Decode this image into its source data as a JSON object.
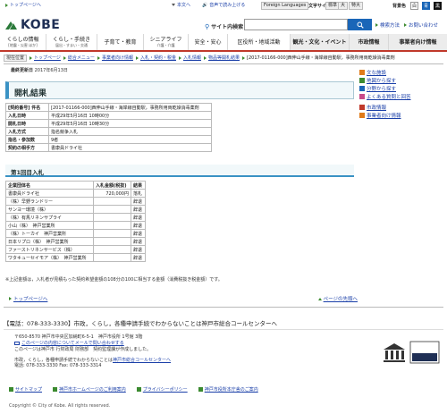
{
  "topbar": {
    "top_link": "トップページへ",
    "text_version": "本文へ",
    "speech": "音声で読み上げる",
    "foreign": "Foreign Languages",
    "font_size_label": "文字サイズ",
    "font_standard": "標準",
    "font_large": "大",
    "font_xlarge": "特大",
    "bg_label": "背景色",
    "bg_white": "白",
    "bg_blue": "青",
    "bg_black": "黒"
  },
  "header": {
    "logo_text": "KOBE",
    "search_label": "サイト内検索",
    "search_placeholder": "",
    "search_method": "検索方法",
    "inquiry": "お問い合わせ"
  },
  "nav": [
    {
      "label": "くらしの情報",
      "sub": "[地震・災害 ほか]"
    },
    {
      "label": "くらし・手続き",
      "sub": "届出・すまい・交通"
    },
    {
      "label": "子育て・教育",
      "sub": ""
    },
    {
      "label": "シニアライフ",
      "sub": "介護・介護"
    },
    {
      "label": "安全・安心",
      "sub": ""
    },
    {
      "label": "区役所・地域活動",
      "sub": ""
    },
    {
      "label": "観光・文化・イベント",
      "sub": ""
    },
    {
      "label": "市政情報",
      "sub": ""
    },
    {
      "label": "事業者向け情報",
      "sub": ""
    }
  ],
  "breadcrumb": {
    "here": "現在位置",
    "items": [
      "トップページ",
      "総合メニュー",
      "事業者向け情報",
      "入札・契約・税金",
      "入札情報",
      "物品等開札結果"
    ],
    "current": "[2017-01166-000]西伸山手線・海岸線自動駅，事務所用両乾燥消毒薬剤"
  },
  "updated": {
    "label": "最終更新日",
    "date": "2017年6月13日"
  },
  "right_links": [
    {
      "label": "文な施設",
      "color": "#1a3fa8"
    },
    {
      "label": "地図から探す",
      "color": "#1a3fa8"
    },
    {
      "label": "分野から探す",
      "color": "#1a3fa8"
    },
    {
      "label": "よくある質問と回答",
      "color": "#1a3fa8"
    },
    {
      "label": "市政情報",
      "color": "#1a3fa8"
    },
    {
      "label": "事業者向け情報",
      "color": "#1a3fa8"
    }
  ],
  "page_title": "開札結果",
  "summary_table": [
    {
      "label": "[契約番号] 件名",
      "value": "[2017-01166-000]西伸山手線・海岸線自動駅，事務所用両乾燥消毒薬剤"
    },
    {
      "label": "入札日時",
      "value": "平成29年5月16日 10時00分"
    },
    {
      "label": "開札日時",
      "value": "平成29年5月16日 10時30分"
    },
    {
      "label": "入札方式",
      "value": "指名競争入札"
    },
    {
      "label": "指名・参加数",
      "value": "9者"
    },
    {
      "label": "契約の相手方",
      "value": "書康員ドライ社"
    }
  ],
  "section_title": "第1回目入札",
  "bid_table": {
    "headers": [
      "企業団体名",
      "入札金額(税抜)",
      "結果"
    ],
    "rows": [
      [
        "書康員ドライ社",
        "720,000円",
        "落札"
      ],
      [
        "（株）早野ランドリー",
        "",
        "辞退"
      ],
      [
        "サンヨー環境（株）",
        "",
        "辞退"
      ],
      [
        "（株）有馬リネンサプライ",
        "",
        "辞退"
      ],
      [
        "小山（株）　神戸営業所",
        "",
        "辞退"
      ],
      [
        "（株）トーカイ　神戸営業所",
        "",
        "辞退"
      ],
      [
        "日本リプロ（株）　神戸営業所",
        "",
        "辞退"
      ],
      [
        "ファーストリネンサービス（株）",
        "",
        "辞退"
      ],
      [
        "ワタキューセイモア（株）　神戸営業所",
        "",
        "辞退"
      ]
    ]
  },
  "note": "※上記金額は，入札者が見積もった契約希望金額の108分の100に相当する金額（消費税抜き税金額）です。",
  "page_nav": {
    "top": "トップページへ",
    "back": "ページの先頭へ"
  },
  "footer": {
    "call_center": "【電話：078-333-3330】市政，くらし，各種申請手続でわからないことは神戸市総合コールセンターへ",
    "address": "〒650-8570 神戸市中央区加納町6-5-1　神戸市役所 1号館 3階",
    "mail_link": "このページの内容についてメールで問い合わせする",
    "dept": "このページは神戸市 行財政局 財務部　契約監理課が作成しました。",
    "call_prefix": "市政，くらし，各種申請手続でわからないことは",
    "call_link": "神戸市総合コールセンターへ",
    "tel": "電話: 078-333-3330 Fax: 078-333-3314",
    "links": [
      "サイトマップ",
      "神戸市ホームページのご利用案内",
      "プライバシーポリシー",
      "神戸市役所本庁舎のご案内"
    ],
    "copyright": "Copyright © City of Kobe. All rights reserved."
  }
}
